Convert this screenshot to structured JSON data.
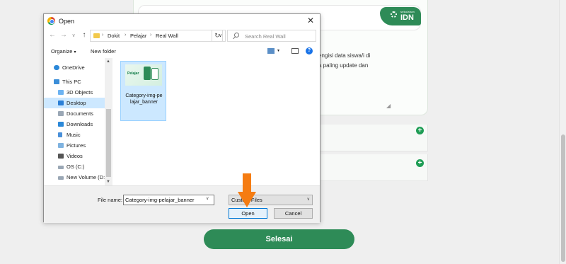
{
  "page": {
    "textarea_lines": [
      "engisi data siswa/i di",
      "a paling update dan"
    ],
    "brand_small": "sekolahan",
    "brand_big": "IDN",
    "finish_button": "Selesai",
    "accent_color": "#2e8b57"
  },
  "dialog": {
    "title": "Open",
    "close": "✕",
    "breadcrumb": [
      "Dokit",
      "Pelajar",
      "Real Wall"
    ],
    "search_placeholder": "Search Real Wall",
    "toolbar": {
      "organize": "Organize",
      "new_folder": "New folder"
    },
    "nav_items": [
      {
        "label": "OneDrive",
        "icon": "cloud-icon"
      },
      {
        "label": "This PC",
        "icon": "computer-icon"
      },
      {
        "label": "3D Objects",
        "icon": "cube-icon"
      },
      {
        "label": "Desktop",
        "icon": "desktop-icon",
        "selected": true
      },
      {
        "label": "Documents",
        "icon": "document-icon"
      },
      {
        "label": "Downloads",
        "icon": "download-icon"
      },
      {
        "label": "Music",
        "icon": "music-icon"
      },
      {
        "label": "Pictures",
        "icon": "picture-icon"
      },
      {
        "label": "Videos",
        "icon": "video-icon"
      },
      {
        "label": "OS (C:)",
        "icon": "drive-icon"
      },
      {
        "label": "New Volume (D:)",
        "icon": "drive-icon"
      }
    ],
    "file": {
      "name": "Category-img-pelajar_banner",
      "name_wrapped": "Category-img-pe lajar_banner",
      "thumb_text": "Pelajar"
    },
    "file_name_label": "File name:",
    "file_name_value": "Category-img-pelajar_banner",
    "file_type": "Custom Files",
    "open_button": "Open",
    "cancel_button": "Cancel"
  }
}
